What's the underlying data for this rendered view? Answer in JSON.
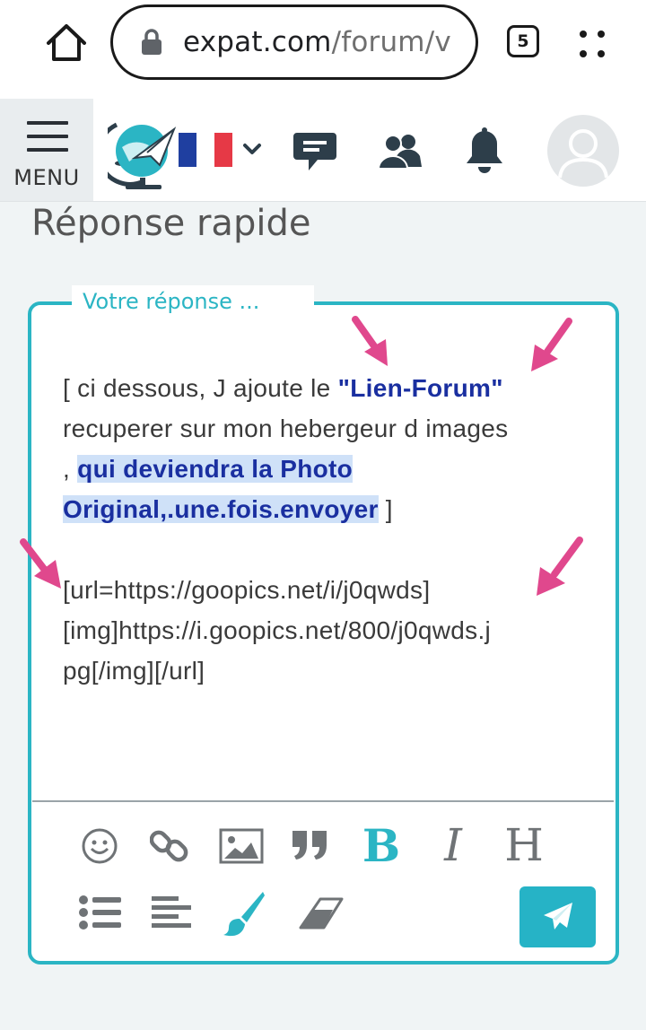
{
  "browser": {
    "url_domain": "expat.com",
    "url_path": "/forum/v",
    "tab_count": "5"
  },
  "header": {
    "menu_label": "MENU",
    "language": "FR"
  },
  "page": {
    "title": "Réponse rapide"
  },
  "reply": {
    "legend": "Votre réponse ...",
    "line1_prefix": "[ ci dessous, J ajoute le ",
    "line1_link": "\"Lien-Forum\"",
    "line2": "recuperer sur mon hebergeur d images",
    "line3_prefix": ", ",
    "line3_highlight": " qui deviendra la Photo ",
    "line4_highlight": "Original,.une.fois.envoyer",
    "line4_suffix": " ]",
    "code1": "[url=https://goopics.net/i/j0qwds]",
    "code2": "[img]https://i.goopics.net/800/j0qwds.j",
    "code3": "pg[/img][/url]"
  },
  "toolbar": {
    "bold": "B",
    "italic": "I",
    "heading": "H",
    "quote": "❞"
  },
  "colors": {
    "accent": "#2bb5c4",
    "arrow": "#e0488d",
    "link_blue": "#1a2fa0",
    "icon_dark": "#2d3e4a"
  }
}
